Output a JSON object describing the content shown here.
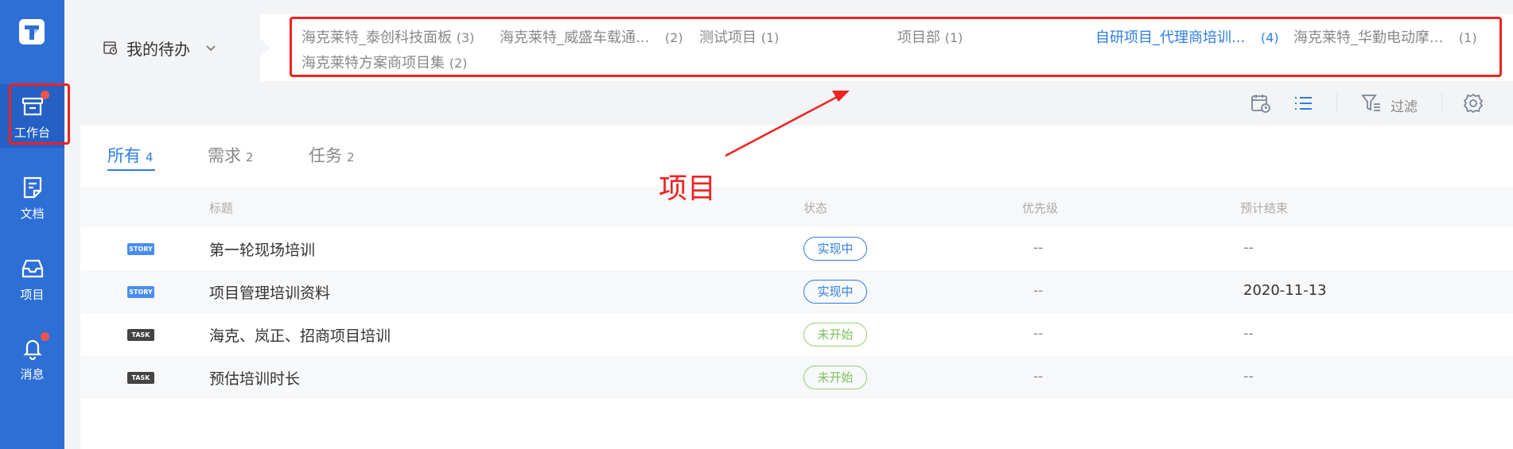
{
  "sidebar": {
    "items": [
      {
        "label": "工作台",
        "active": true,
        "dot": true
      },
      {
        "label": "文档",
        "active": false,
        "dot": false
      },
      {
        "label": "项目",
        "active": false,
        "dot": false
      },
      {
        "label": "消息",
        "active": false,
        "dot": true
      }
    ]
  },
  "header": {
    "todo_label": "我的待办",
    "projects": [
      {
        "name": "海克莱特_泰创科技面板",
        "count": "(3)",
        "active": false
      },
      {
        "name": "海克莱特_威盛车载通...",
        "count": "(2)",
        "active": false
      },
      {
        "name": "测试项目",
        "count": "(1)",
        "active": false
      },
      {
        "name": "项目部",
        "count": "(1)",
        "active": false
      },
      {
        "name": "自研项目_代理商培训...",
        "count": "(4)",
        "active": true
      },
      {
        "name": "海克莱特_华勤电动摩...",
        "count": "(1)",
        "active": false
      },
      {
        "name": "海克莱特方案商项目集",
        "count": "(2)",
        "active": false
      }
    ]
  },
  "toolbar": {
    "filter_label": "过滤",
    "icons": [
      "calendar-icon",
      "list-view-icon",
      "filter-icon",
      "settings-gear-icon"
    ]
  },
  "tabs": [
    {
      "label": "所有",
      "count": "4",
      "active": true
    },
    {
      "label": "需求",
      "count": "2",
      "active": false
    },
    {
      "label": "任务",
      "count": "2",
      "active": false
    }
  ],
  "table": {
    "columns": [
      "标题",
      "状态",
      "优先级",
      "预计结束"
    ],
    "rows": [
      {
        "type": "STORY",
        "title": "第一轮现场培训",
        "status": "实现中",
        "priority": "--",
        "end": "--"
      },
      {
        "type": "STORY",
        "title": "项目管理培训资料",
        "status": "实现中",
        "priority": "--",
        "end": "2020-11-13"
      },
      {
        "type": "TASK",
        "title": "海克、岚正、招商项目培训",
        "status": "未开始",
        "priority": "--",
        "end": "--"
      },
      {
        "type": "TASK",
        "title": "预估培训时长",
        "status": "未开始",
        "priority": "--",
        "end": "--"
      }
    ]
  },
  "annotation": {
    "label": "项目",
    "color": "#f02222"
  },
  "colors": {
    "sidebar": "#2e6fd6",
    "accent": "#2e7ee0",
    "not_started": "#7cc05a"
  }
}
